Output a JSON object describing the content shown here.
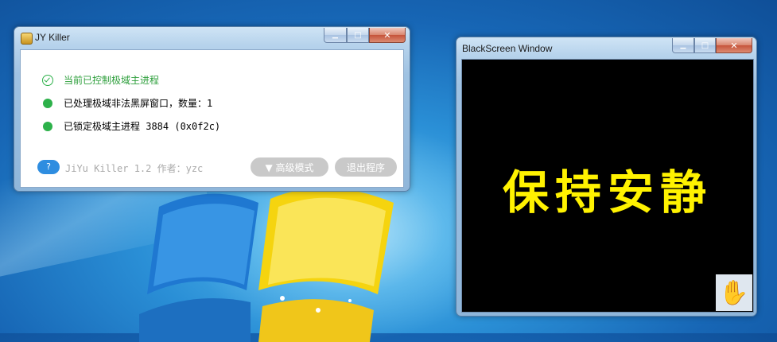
{
  "jy_window": {
    "title": "JY Killer",
    "status": [
      {
        "text": "当前已控制极域主进程",
        "state": "ok"
      },
      {
        "text": "已处理极域非法黑屏窗口，数量：1",
        "state": "done"
      },
      {
        "text": "已锁定极域主进程 3884 (0x0f2c)",
        "state": "done"
      }
    ],
    "help_label": "?",
    "version_text": "JiYu Killer 1.2 作者：yzc",
    "advanced_button": "▼ 高级模式",
    "exit_button": "退出程序",
    "min_glyph": "▁",
    "max_glyph": "□",
    "close_glyph": "✕"
  },
  "bs_window": {
    "title": "BlackScreen Window",
    "message": "保持安静",
    "hand_glyph": "✋",
    "min_glyph": "▁",
    "max_glyph": "□",
    "close_glyph": "✕"
  },
  "colors": {
    "status_green": "#2db14a",
    "message_yellow": "#fff200",
    "help_blue": "#2e8de0"
  }
}
